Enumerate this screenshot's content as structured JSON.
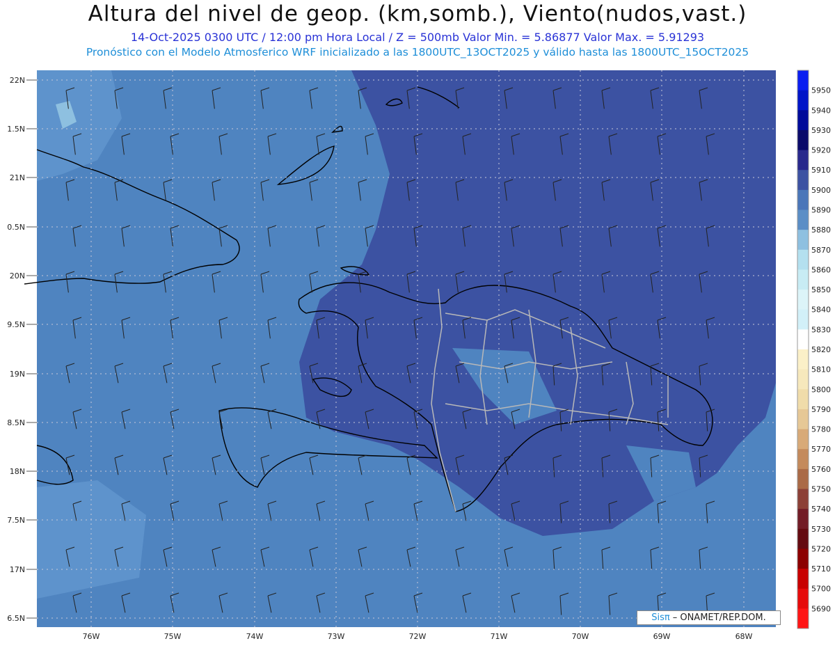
{
  "header": {
    "title": "Altura del nivel de geop. (km,somb.), Viento(nudos,vast.)",
    "line2": "14-Oct-2025  0300 UTC / 12:00 pm Hora Local / Z = 500mb    Valor Min. = 5.86877  Valor Max. = 5.91293",
    "line3": "Pronóstico con el Modelo Atmosferico WRF inicializado a las 1800UTC_13OCT2025 y válido hasta las  1800UTC_15OCT2025"
  },
  "map": {
    "lat_labels": [
      "22N",
      "1.5N",
      "21N",
      "0.5N",
      "20N",
      "9.5N",
      "19N",
      "8.5N",
      "18N",
      "7.5N",
      "17N",
      "6.5N"
    ],
    "lon_labels": [
      "76W",
      "75W",
      "74W",
      "73W",
      "72W",
      "71W",
      "70W",
      "69W",
      "68W"
    ],
    "fill_colors": {
      "low": "#5b8ec6",
      "mid": "#4a76b9",
      "high": "#3c52a2",
      "light": "#7fb2da"
    }
  },
  "colorbar": {
    "levels": [
      "5950",
      "5940",
      "5930",
      "5920",
      "5910",
      "5900",
      "5890",
      "5880",
      "5870",
      "5860",
      "5850",
      "5840",
      "5830",
      "5820",
      "5810",
      "5800",
      "5790",
      "5780",
      "5770",
      "5760",
      "5750",
      "5740",
      "5730",
      "5720",
      "5710",
      "5700",
      "5690"
    ],
    "colors": [
      "#0a1ef0",
      "#0014c8",
      "#000a9a",
      "#0a0a6a",
      "#28288c",
      "#3c52a2",
      "#4a76b9",
      "#5b8ec6",
      "#8ec0e0",
      "#b4e0ef",
      "#c8ecf4",
      "#dcf4f8",
      "#d2f0f8",
      "#ffffff",
      "#fbf0c8",
      "#f6e8bc",
      "#f0dcaa",
      "#e6c896",
      "#d8aa78",
      "#c48a5c",
      "#aa6a46",
      "#8c4036",
      "#721c26",
      "#640a10",
      "#8c0000",
      "#c80000",
      "#e60a0a",
      "#ff1414"
    ]
  },
  "credit": {
    "sis": "Sisπ",
    "text": "– ONAMET/REP.DOM."
  }
}
